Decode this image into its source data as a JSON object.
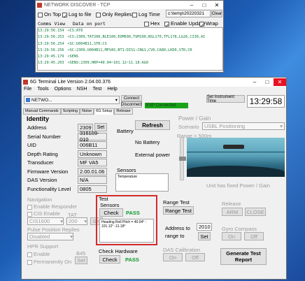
{
  "nd": {
    "title": "NETWORK DISCOVER - TCP",
    "opt_on_top": "On Top",
    "opt_log_file": "Log to file",
    "opt_replies": "Only Replies",
    "opt_log_time": "Log Time",
    "path": "c:\\temp\\20220321",
    "clear": "Clear",
    "col_comms": "Comms View",
    "col_data": "Data on port",
    "hex": "Hex",
    "enable_update": "Enable Update",
    "wrap": "Wrap",
    "log": [
      [
        "13:29:56.154",
        "<CS:AT0"
      ],
      [
        "13:29:56.253",
        "<CS:2309,TAT200,BLE100,EOM500,TUM190,NSL170,TFL178,LG26,CI30,AI"
      ],
      [
        "13:29:56.254",
        "<SC:U004B11,STR:CS"
      ],
      [
        "13:29:56.256",
        "<SC:2309,U004B11,MFVA5,BT1:DIS1:CNG1,CV0,CA80,LKD0,STR,CR"
      ],
      [
        "13:29:45.179",
        "<SENS"
      ],
      [
        "13:29:45.203",
        "<SENS:2309,HRP=40.04~101.12~11.18:AG0"
      ]
    ]
  },
  "gt": {
    "title": "6G Terminal Lite Version 2.04.00.376",
    "menu": [
      "File",
      "Tools",
      "Options",
      "NSH",
      "Test",
      "Help"
    ],
    "conn": "NETWO...",
    "connect": "Connect",
    "disconnect": "Disconnect",
    "status": "ESP Connected",
    "set_time": "Set Instrument Time",
    "clock": "13:29:58",
    "tabs": [
      "Manual Commands",
      "Scripting",
      "Noise",
      "6G Setup",
      "Release"
    ],
    "identity": {
      "title": "Identity",
      "rows": [
        {
          "label": "Address",
          "value": "2309"
        },
        {
          "label": "Serial Number",
          "value": "316109-010"
        },
        {
          "label": "UID",
          "value": "006B11"
        },
        {
          "label": "Depth Rating",
          "value": "Unknown"
        },
        {
          "label": "Transducer",
          "value": "MF VA5"
        },
        {
          "label": "Firmware Version",
          "value": "2.00.01.06"
        },
        {
          "label": "DAS Version",
          "value": "N/A"
        },
        {
          "label": "Functionality Level",
          "value": "0805"
        }
      ],
      "set": "Set"
    },
    "battery": {
      "title": "Battery",
      "refresh": "Refresh",
      "no_batt": "No Battery",
      "ext": "External power"
    },
    "sensors": {
      "title": "Sensors",
      "item": "Temperature"
    },
    "power": {
      "title": "Power / Gain",
      "scenario_label": "Scenario",
      "scenario": "USBL Positioning",
      "range": "Range = 500m",
      "fixed": "Unit has fixed Power / Gain"
    },
    "navigation": {
      "title": "Navigation",
      "enable_responder": "Enable Responder",
      "cis_enable": "CIS Enable",
      "tat": "TAT",
      "cis": "CIS1600",
      "tat_val": "200",
      "set": "Set",
      "pulse": "Pulse Position Replies",
      "pulse_val": "Disabled"
    },
    "hpr": {
      "title": "HPR Support",
      "enable": "Enable",
      "perm": "Permanently On",
      "b45": "B45",
      "set": "Set"
    },
    "test": {
      "title": "Test",
      "sensors": "Sensors",
      "check": "Check",
      "pass": "PASS",
      "result": "Heading Roll Pitch = 40.04° - 101.12° -11.18°"
    },
    "hardware": {
      "title": "Check Hardware",
      "check": "Check",
      "pass": "PASS"
    },
    "range_test": {
      "title": "Range Test",
      "button": "Range Test",
      "addr": "Address to range to",
      "addr_val": "2010",
      "set": "Set"
    },
    "release": {
      "title": "Release",
      "arm": "ARM",
      "close": "CLOSE"
    },
    "gyro": {
      "title": "Gyro Compass",
      "on": "On",
      "off": "Off"
    },
    "das": {
      "title": "DAS Calibration",
      "on": "On",
      "off": "Off"
    },
    "report": "Generate Test Report"
  }
}
